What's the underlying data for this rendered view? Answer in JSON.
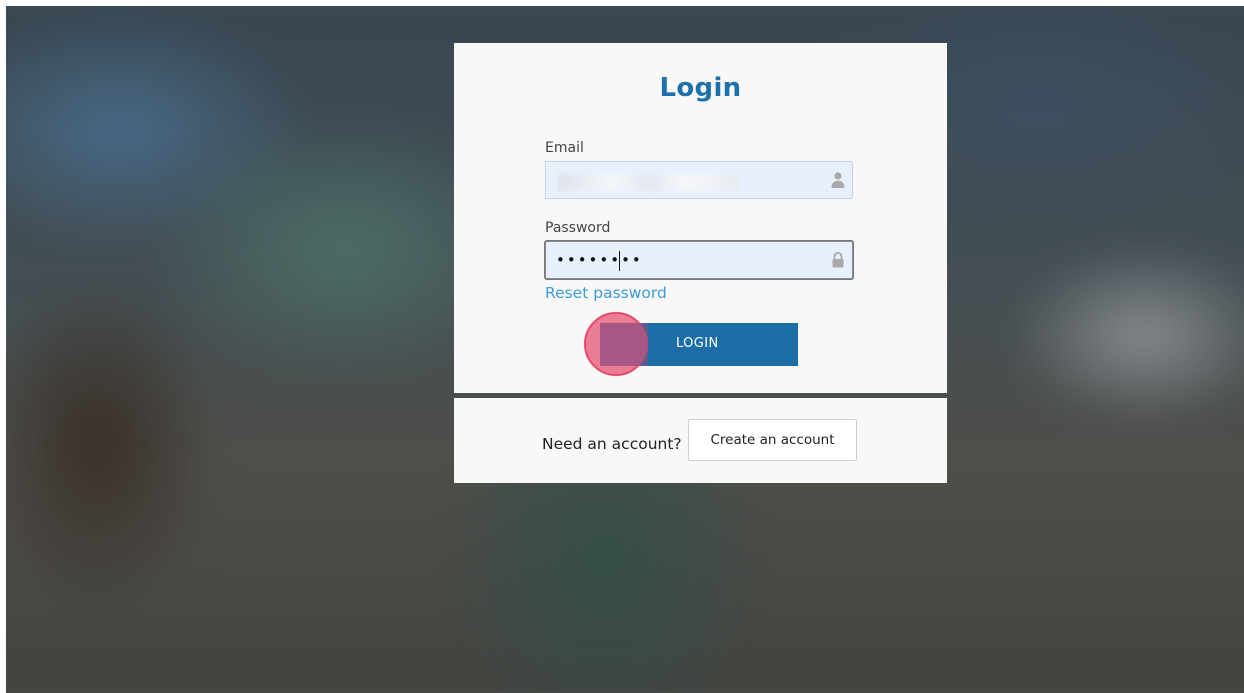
{
  "login_card": {
    "title": "Login",
    "email_label": "Email",
    "email_value": "",
    "password_label": "Password",
    "password_value": "••••••••",
    "reset_link": "Reset password",
    "login_button": "LOGIN"
  },
  "signup_card": {
    "prompt": "Need an account?",
    "create_button": "Create an account"
  },
  "icons": {
    "email_field_icon": "user-icon",
    "password_field_icon": "lock-icon"
  },
  "colors": {
    "accent": "#1d70aa",
    "link": "#3e9bd3",
    "click_indicator": "#e8486e"
  }
}
